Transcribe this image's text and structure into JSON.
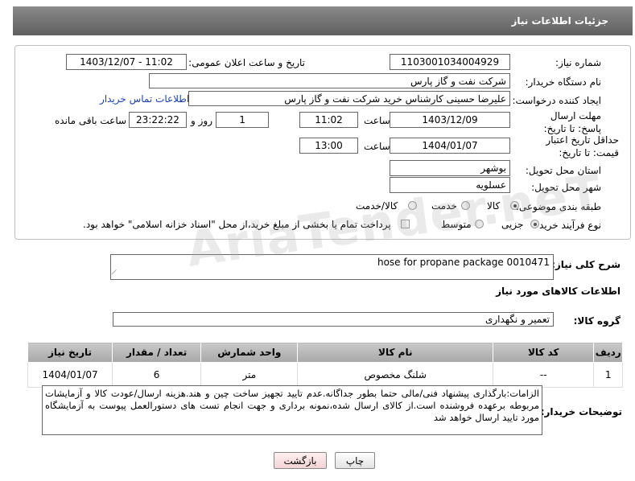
{
  "header": {
    "title": "جزئیات اطلاعات نیاز"
  },
  "fields": {
    "need_number_label": "شماره نیاز:",
    "need_number": "1103001034004929",
    "announce_label": "تاریخ و ساعت اعلان عمومی:",
    "announce_value": "1403/12/07 - 11:02",
    "buyer_org_label": "نام دستگاه خریدار:",
    "buyer_org": "شرکت نفت و گاز پارس",
    "creator_label": "ایجاد کننده درخواست:",
    "creator": "علیرضا حسینی کارشناس خرید شرکت نفت و گاز پارس",
    "contact_link": "اطلاعات تماس خریدار",
    "deadline_label": "مهلت ارسال پاسخ: تا تاریخ:",
    "deadline_date": "1403/12/09",
    "time_label": "ساعت",
    "deadline_time": "11:02",
    "days_value": "1",
    "days_label": "روز و",
    "remaining_time": "23:22:22",
    "remaining_label": "ساعت باقی مانده",
    "validity_label": "حداقل تاریخ اعتبار قیمت: تا تاریخ:",
    "validity_date": "1404/01/07",
    "validity_time_label": "ساعت",
    "validity_time": "13:00",
    "province_label": "استان محل تحویل:",
    "province": "بوشهر",
    "city_label": "شهر محل تحویل:",
    "city": "عسلویه",
    "category_label": "طبقه بندی موضوعی:",
    "category_options": [
      "کالا",
      "خدمت",
      "کالا/خدمت"
    ],
    "process_label": "نوع فرآیند خرید :",
    "process_options": [
      "جزیی",
      "متوسط"
    ],
    "payment_note": "پرداخت تمام یا بخشی از مبلغ خرید،از محل \"اسناد خزانه اسلامی\" خواهد بود."
  },
  "description": {
    "label": "شرح کلی نیاز:",
    "value": "hose for propane package 0010471"
  },
  "goods_info_title": "اطلاعات کالاهای مورد نیاز",
  "goods_group": {
    "label": "گروه کالا:",
    "value": "تعمیر و نگهداری"
  },
  "table": {
    "headers": [
      "ردیف",
      "کد کالا",
      "نام کالا",
      "واحد شمارش",
      "تعداد / مقدار",
      "تاریخ نیاز"
    ],
    "rows": [
      [
        "1",
        "--",
        "شلنگ مخصوص",
        "متر",
        "6",
        "1404/01/07"
      ]
    ]
  },
  "buyer_notes": {
    "label": "توضیحات خریدار:",
    "value": "الزامات:بارگذاری پیشنهاد فنی/مالی حتما بطور جداگانه.عدم تایید تجهیز ساخت چین و هند.هزینه ارسال/عودت کالا و آزمایشات مربوطه برعهده فروشنده است.از کالای ارسال شده،نمونه برداری و جهت انجام تست های دستورالعمل پیوست به آزمایشگاه مورد تایید ارسال خواهد شد"
  },
  "buttons": {
    "print": "چاپ",
    "back": "بازگشت"
  },
  "watermark": "AriaTender.neT"
}
